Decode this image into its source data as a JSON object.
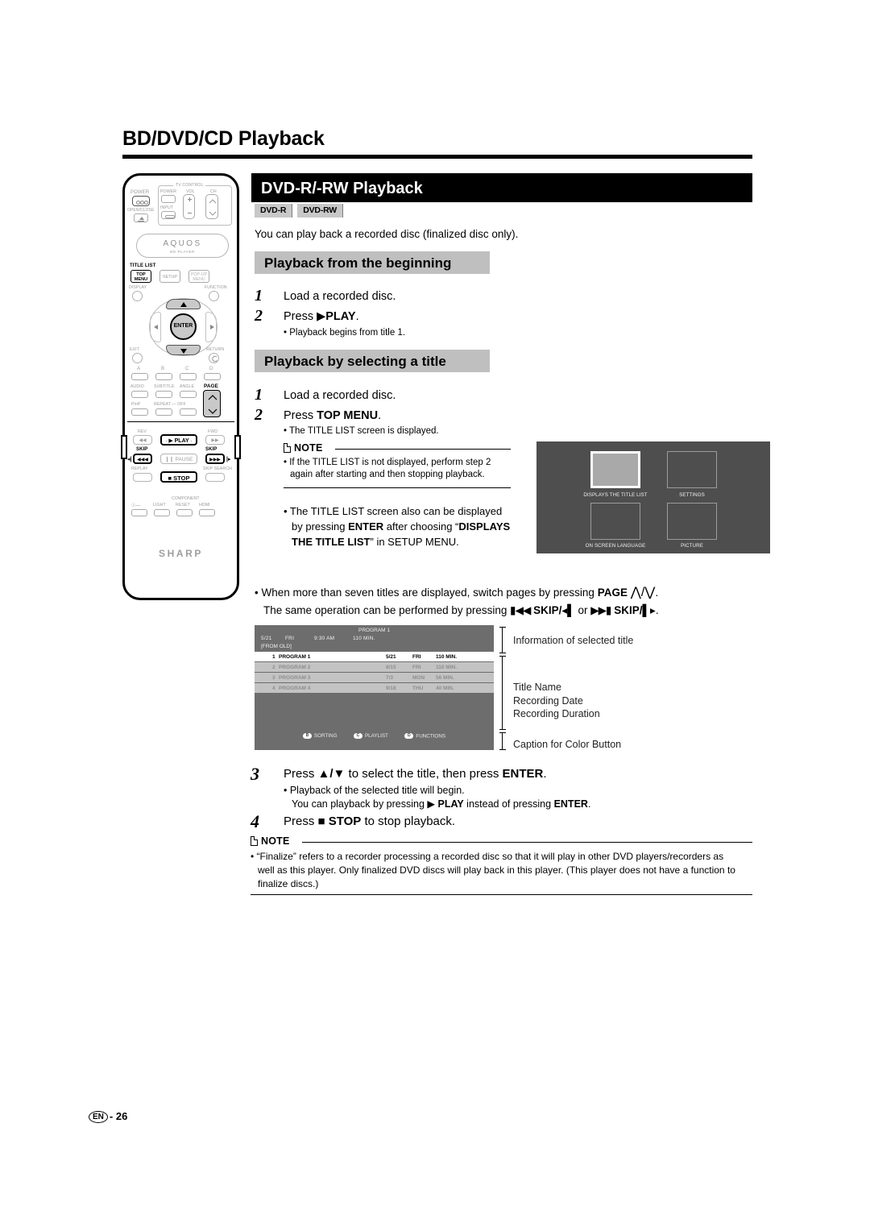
{
  "page": {
    "title": "BD/DVD/CD Playback",
    "footer_lang": "EN",
    "footer_page": "- 26"
  },
  "section": {
    "heading": "DVD-R/-RW Playback",
    "badges": [
      "DVD-R",
      "DVD-RW"
    ],
    "intro": "You can play back a recorded disc (finalized disc only)."
  },
  "sub1": {
    "heading": "Playback from the beginning",
    "steps": [
      {
        "num": "1",
        "text": "Load a recorded disc."
      },
      {
        "num": "2",
        "text": "Press ▶PLAY.",
        "bullet": "• Playback begins from title 1."
      }
    ]
  },
  "sub2": {
    "heading": "Playback by selecting a title",
    "step1_num": "1",
    "step1_text": "Load a recorded disc.",
    "step2_num": "2",
    "step2_text": "Press TOP MENU.",
    "step2_bullet": "• The TITLE LIST screen is displayed.",
    "note_label": "NOTE",
    "note_line1": "• If the TITLE LIST is not displayed, perform step 2",
    "note_line2": "again after starting and then stopping playback.",
    "bullet2_line1": "• The TITLE LIST screen also can be displayed",
    "bullet2_line2": "by pressing ENTER after choosing “DISPLAYS",
    "bullet2_line3": "THE TITLE LIST” in SETUP MENU.",
    "page_bullet_line1": "• When more than seven titles are displayed, switch pages by pressing PAGE ⋀/⋁.",
    "page_bullet_line2": "The same operation can be performed by pressing ◀◀ SKIP/◀│ or ▶▶ SKIP/│▶."
  },
  "setup_menu": {
    "cells": [
      {
        "caption": "DISPLAYS THE TITLE LIST",
        "selected": true
      },
      {
        "caption": "SETTINGS",
        "selected": false
      },
      {
        "caption": "ON SCREEN LANGUAGE",
        "selected": false
      },
      {
        "caption": "PICTURE",
        "selected": false
      }
    ]
  },
  "title_list": {
    "header_program": "PROGRAM 1",
    "header_date": "5/21",
    "header_day": "FRI",
    "header_time": "9:30 AM",
    "header_dur": "110 MIN.",
    "sort_order": "[FROM OLD]",
    "rows": [
      {
        "n": "1",
        "name": "PROGRAM 1",
        "date": "5/21",
        "day": "FRI",
        "dur": "110 MIN.",
        "selected": true
      },
      {
        "n": "2",
        "name": "PROGRAM 2",
        "date": "8/15",
        "day": "FRI",
        "dur": "110 MIN.",
        "selected": false
      },
      {
        "n": "3",
        "name": "PROGRAM 3",
        "date": "7/3",
        "day": "MON",
        "dur": "56 MIN.",
        "selected": false
      },
      {
        "n": "4",
        "name": "PROGRAM 4",
        "date": "9/18",
        "day": "THU",
        "dur": "40 MIN.",
        "selected": false
      }
    ],
    "color_buttons": [
      {
        "key": "B",
        "label": "SORTING"
      },
      {
        "key": "C",
        "label": "PLAYLIST"
      },
      {
        "key": "D",
        "label": "FUNCTIONS"
      }
    ],
    "callouts": {
      "info": "Information of selected title",
      "detail_line1": "Title Name",
      "detail_line2": "Recording Date",
      "detail_line3": "Recording Duration",
      "caption": "Caption for Color Button"
    }
  },
  "steps34": {
    "step3_num": "3",
    "step3_text": "Press ▲/▼ to select the title, then press ENTER.",
    "step3_b1": "• Playback of the selected title will begin.",
    "step3_b2": "You can playback by pressing ▶ PLAY instead of pressing ENTER.",
    "step4_num": "4",
    "step4_text": "Press ■ STOP to stop playback."
  },
  "final_note": {
    "label": "NOTE",
    "line1": "• “Finalize” refers to a recorder processing a recorded disc so that it will play in other DVD players/recorders as",
    "line2": "well as this player. Only finalized DVD discs will play back in this player. (This player does not have a function to",
    "line3": "finalize discs.)"
  },
  "remote": {
    "brand": "SHARP",
    "logo": "AQUOS",
    "logo_sub": "BD PLAYER",
    "tv_control": "TV CONTROL",
    "labels": {
      "power": "POWER",
      "open_close": "OPEN/CLOSE",
      "tv_power": "POWER",
      "vol": "VOL",
      "ch": "CH",
      "input": "INPUT",
      "title_list": "TITLE LIST",
      "top_menu_l1": "TOP",
      "top_menu_l2": "MENU",
      "setup": "SETUP",
      "popup_l1": "POP-UP",
      "popup_l2": "MENU",
      "display": "DISPLAY",
      "function": "FUNCTION",
      "enter": "ENTER",
      "exit": "EXIT",
      "return": "RETURN",
      "a": "A",
      "b": "B",
      "c": "C",
      "d": "D",
      "audio": "AUDIO",
      "subtitle": "SUBTITLE",
      "angle": "ANGLE",
      "page": "PAGE",
      "pinp": "PinP",
      "repeat": "REPEAT — OFF",
      "rev": "REV",
      "fwd": "FWD",
      "play": "▶ PLAY",
      "skip_l": "SKIP",
      "skip_r": "SKIP",
      "pause": "❙❙ PAUSE",
      "replay": "REPLAY",
      "stop": "■ STOP",
      "skip_search": "SKIP SEARCH",
      "component": "COMPONENT",
      "light": "LIGHT",
      "reset": "RESET",
      "hdmi": "HDMI"
    }
  }
}
